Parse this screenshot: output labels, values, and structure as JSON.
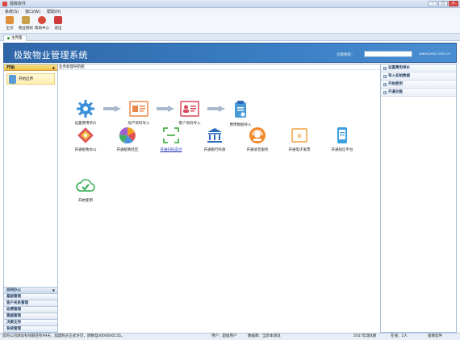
{
  "window": {
    "title": "极致软件",
    "controls": [
      "-",
      "□",
      "×"
    ]
  },
  "menu": [
    "系统(S)",
    "窗口(W)",
    "帮助(H)"
  ],
  "toolbar": [
    {
      "label": "主页",
      "icon": "home-icon",
      "color": "#e0903a"
    },
    {
      "label": "物业授权",
      "icon": "license-icon",
      "color": "#c8a04a"
    },
    {
      "label": "帮助中心",
      "icon": "help-icon",
      "color": "#d84a3a"
    },
    {
      "label": "退出",
      "icon": "exit-icon",
      "color": "#d03a3a"
    }
  ],
  "tab": "主界面",
  "banner": {
    "title": "极致物业管理系统",
    "search_label": "功能搜索：",
    "search_value": "",
    "url": "www.jeez.com.cn"
  },
  "left_panel": {
    "header": "开始",
    "item": "开始启用",
    "groups": [
      "协同办公",
      "基础管理",
      "客户关系管理",
      "收费管理",
      "票据管理",
      "决策支持",
      "系统管理"
    ]
  },
  "main": {
    "header": "业务处理导航图",
    "flow": [
      {
        "label": "设置费用单价",
        "icon": "gear-icon",
        "color": "#3b8fd8"
      },
      {
        "label": "房产资料导入",
        "icon": "house-doc-icon",
        "color": "#e8874a"
      },
      {
        "label": "客户资料导入",
        "icon": "contact-card-icon",
        "color": "#d8485a"
      },
      {
        "label": "费用数据导入",
        "icon": "bill-import-icon",
        "color": "#4a9ad8"
      }
    ],
    "features": [
      {
        "label": "开通极致办公",
        "icon": "office-icon",
        "color": "#e05a5a",
        "link": false
      },
      {
        "label": "开通极致社区",
        "icon": "community-icon",
        "color": "#f0a020",
        "link": false
      },
      {
        "label": "开通扫码支付",
        "icon": "scan-pay-icon",
        "color": "#4ab04a",
        "link": true
      },
      {
        "label": "开通银行托收",
        "icon": "bank-icon",
        "color": "#2a6ab8",
        "link": false
      },
      {
        "label": "开通语音服务",
        "icon": "voice-icon",
        "color": "#f08a2a",
        "link": false
      },
      {
        "label": "开通电子发票",
        "icon": "e-invoice-icon",
        "color": "#f0a040",
        "link": false
      },
      {
        "label": "开通短信平台",
        "icon": "sms-icon",
        "color": "#3aa0e0",
        "link": false
      },
      {
        "label": "开始使用",
        "icon": "cloud-check-icon",
        "color": "#2ea84a",
        "link": false
      }
    ]
  },
  "right_panel": [
    "设置费用单价",
    "导入初始数据",
    "开始使用",
    "开通功能"
  ],
  "status": {
    "message": "您的公司测试有效期还有99天，加盟购买正式许可，请致电4000000135。",
    "user": "用户：超级用户",
    "db": "数据库：全新本测试",
    "period": "2017年第8期",
    "online": "在线：2人",
    "brand": "极致软件"
  }
}
